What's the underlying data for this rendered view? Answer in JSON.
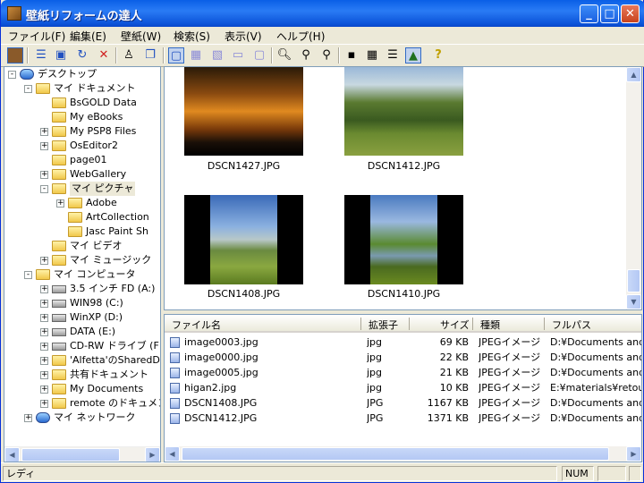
{
  "window": {
    "title": "壁紙リフォームの達人"
  },
  "menu": [
    "ファイル(F)",
    "編集(E)",
    "壁紙(W)",
    "検索(S)",
    "表示(V)",
    "ヘルプ(H)"
  ],
  "tree": {
    "items": [
      {
        "label": "デスクトップ",
        "indent": 0,
        "icon": "desktop-icon",
        "exp": "-"
      },
      {
        "label": "マイ ドキュメント",
        "indent": 1,
        "icon": "my-documents-icon",
        "exp": "-"
      },
      {
        "label": "BsGOLD Data",
        "indent": 2,
        "icon": "folder-icon",
        "exp": ""
      },
      {
        "label": "My eBooks",
        "indent": 2,
        "icon": "folder-icon",
        "exp": ""
      },
      {
        "label": "My PSP8 Files",
        "indent": 2,
        "icon": "folder-icon",
        "exp": "+"
      },
      {
        "label": "OsEditor2",
        "indent": 2,
        "icon": "folder-icon",
        "exp": "+"
      },
      {
        "label": "page01",
        "indent": 2,
        "icon": "folder-icon",
        "exp": ""
      },
      {
        "label": "WebGallery",
        "indent": 2,
        "icon": "folder-icon",
        "exp": "+"
      },
      {
        "label": "マイ ピクチャ",
        "indent": 2,
        "icon": "my-pictures-icon",
        "exp": "-",
        "selected": true
      },
      {
        "label": "Adobe",
        "indent": 3,
        "icon": "folder-icon",
        "exp": "+"
      },
      {
        "label": "ArtCollection",
        "indent": 3,
        "icon": "folder-icon",
        "exp": ""
      },
      {
        "label": "Jasc Paint Sh",
        "indent": 3,
        "icon": "folder-icon",
        "exp": ""
      },
      {
        "label": "マイ ビデオ",
        "indent": 2,
        "icon": "my-videos-icon",
        "exp": ""
      },
      {
        "label": "マイ ミュージック",
        "indent": 2,
        "icon": "my-music-icon",
        "exp": "+"
      },
      {
        "label": "マイ コンピュータ",
        "indent": 1,
        "icon": "my-computer-icon",
        "exp": "-"
      },
      {
        "label": "3.5 インチ FD (A:)",
        "indent": 2,
        "icon": "floppy-drive-icon",
        "exp": "+"
      },
      {
        "label": "WIN98 (C:)",
        "indent": 2,
        "icon": "hard-drive-icon",
        "exp": "+"
      },
      {
        "label": "WinXP (D:)",
        "indent": 2,
        "icon": "hard-drive-icon",
        "exp": "+"
      },
      {
        "label": "DATA (E:)",
        "indent": 2,
        "icon": "hard-drive-icon",
        "exp": "+"
      },
      {
        "label": "CD-RW ドライブ (F",
        "indent": 2,
        "icon": "cd-drive-icon",
        "exp": "+"
      },
      {
        "label": "'Alfetta'のSharedDo",
        "indent": 2,
        "icon": "network-share-icon",
        "exp": "+"
      },
      {
        "label": "共有ドキュメント",
        "indent": 2,
        "icon": "folder-icon",
        "exp": "+"
      },
      {
        "label": "My Documents",
        "indent": 2,
        "icon": "folder-icon",
        "exp": "+"
      },
      {
        "label": "remote のドキュメン",
        "indent": 2,
        "icon": "folder-icon",
        "exp": "+"
      },
      {
        "label": "マイ ネットワーク",
        "indent": 1,
        "icon": "my-network-icon",
        "exp": "+"
      }
    ]
  },
  "thumbnails": [
    {
      "caption": "DSCN1427.JPG",
      "scene": "sunset"
    },
    {
      "caption": "DSCN1412.JPG",
      "scene": "trees"
    },
    {
      "caption": "DSCN1408.JPG",
      "scene": "meadow-portrait"
    },
    {
      "caption": "DSCN1410.JPG",
      "scene": "pond-portrait"
    }
  ],
  "filelist": {
    "columns": [
      "ファイル名",
      "拡張子",
      "サイズ",
      "種類",
      "フルパス"
    ],
    "rows": [
      [
        "image0003.jpg",
        "jpg",
        "69 KB",
        "JPEGイメージ",
        "D:¥Documents and S"
      ],
      [
        "image0000.jpg",
        "jpg",
        "22 KB",
        "JPEGイメージ",
        "D:¥Documents and S"
      ],
      [
        "image0005.jpg",
        "jpg",
        "21 KB",
        "JPEGイメージ",
        "D:¥Documents and S"
      ],
      [
        "higan2.jpg",
        "jpg",
        "10 KB",
        "JPEGイメージ",
        "E:¥materials¥retouch"
      ],
      [
        "DSCN1408.JPG",
        "JPG",
        "1167 KB",
        "JPEGイメージ",
        "D:¥Documents and S"
      ],
      [
        "DSCN1412.JPG",
        "JPG",
        "1371 KB",
        "JPEGイメージ",
        "D:¥Documents and S"
      ]
    ]
  },
  "status": {
    "text": "レディ",
    "num": "NUM"
  }
}
